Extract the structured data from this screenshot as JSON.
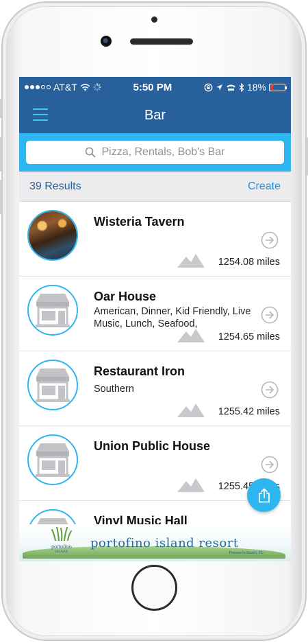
{
  "status_bar": {
    "carrier": "AT&T",
    "time": "5:50 PM",
    "battery": "18%",
    "battery_level": 0.18
  },
  "nav": {
    "title": "Bar",
    "menu_icon": "hamburger-icon"
  },
  "search": {
    "placeholder": "Pizza, Rentals, Bob's Bar",
    "icon": "search-icon"
  },
  "results": {
    "count_label": "39 Results",
    "create_label": "Create"
  },
  "list": [
    {
      "name": "Wisteria Tavern",
      "tags": "",
      "distance": "1254.08 miles",
      "image": "photo"
    },
    {
      "name": "Oar House",
      "tags": "American, Dinner, Kid Friendly, Live Music, Lunch, Seafood,",
      "distance": "1254.65 miles",
      "image": "storefront-icon"
    },
    {
      "name": "Restaurant Iron",
      "tags": "Southern",
      "distance": "1255.42 miles",
      "image": "storefront-icon"
    },
    {
      "name": "Union Public House",
      "tags": "",
      "distance": "1255.45 miles",
      "image": "storefront-icon"
    },
    {
      "name": "Vinyl Music Hall",
      "tags": "",
      "distance": "",
      "image": "storefront-icon"
    }
  ],
  "fab": {
    "icon": "share-icon"
  },
  "ad": {
    "title": "portofino island resort",
    "logo_text": "portofino",
    "logo_sub": "ISLAND",
    "subtitle": "Pensacola Beach, FL"
  },
  "colors": {
    "nav_blue": "#28609c",
    "accent": "#2eb6f0",
    "link": "#1e8fd8"
  }
}
